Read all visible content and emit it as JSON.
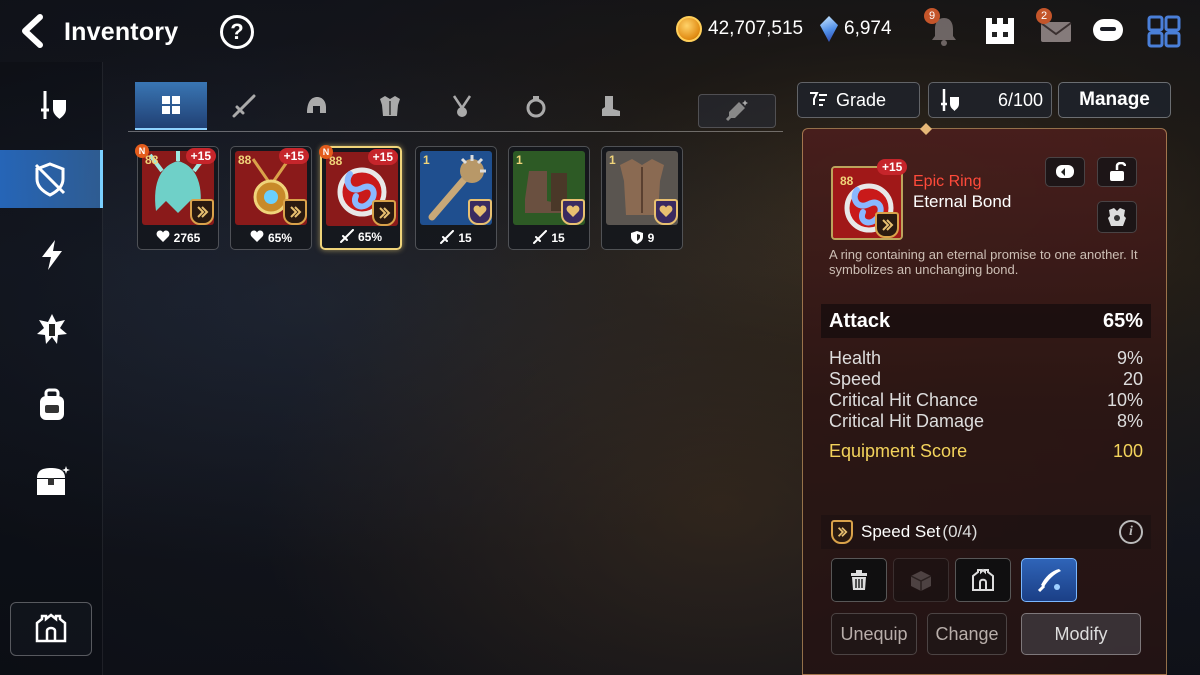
{
  "header": {
    "title": "Inventory",
    "help": "?",
    "gold": "42,707,515",
    "gems": "6,974",
    "notif_count": "9",
    "mail_count": "2"
  },
  "sidebar": {
    "items": [
      {
        "icon": "equipment-icon"
      },
      {
        "icon": "artifact-shield-icon",
        "active": true
      },
      {
        "icon": "lightning-icon"
      },
      {
        "icon": "catalyst-icon"
      },
      {
        "icon": "bag-icon"
      },
      {
        "icon": "chest-icon"
      }
    ],
    "bottom_icon": "fortress-icon"
  },
  "tabs": [
    {
      "icon": "grid-icon",
      "active": true
    },
    {
      "icon": "sword-icon"
    },
    {
      "icon": "helmet-icon"
    },
    {
      "icon": "armor-icon"
    },
    {
      "icon": "necklace-icon"
    },
    {
      "icon": "ring-icon"
    },
    {
      "icon": "boots-icon"
    }
  ],
  "items": [
    {
      "level": "88",
      "plus": "+15",
      "new": "N",
      "stat": "2765",
      "stat_icon": "heart-icon",
      "set": "speed-set-icon",
      "color": "#8a1a1a",
      "type": "helmet"
    },
    {
      "level": "88",
      "plus": "+15",
      "new": "",
      "stat": "65%",
      "stat_icon": "heart-icon",
      "set": "speed-set-icon",
      "color": "#8a1a1a",
      "type": "necklace"
    },
    {
      "level": "88",
      "plus": "+15",
      "new": "N",
      "stat": "65%",
      "stat_icon": "sword-icon",
      "set": "speed-set-icon",
      "color": "#8a1a1a",
      "type": "ring",
      "selected": true
    },
    {
      "level": "1",
      "plus": "",
      "new": "",
      "stat": "15",
      "stat_icon": "sword-icon",
      "set": "heart-set-icon",
      "color": "#1f4f8f",
      "type": "club"
    },
    {
      "level": "1",
      "plus": "",
      "new": "",
      "stat": "15",
      "stat_icon": "sword-icon",
      "set": "heart-set-icon",
      "color": "#2d5a25",
      "type": "boots"
    },
    {
      "level": "1",
      "plus": "",
      "new": "",
      "stat": "9",
      "stat_icon": "shield-icon",
      "set": "heart-set-icon",
      "color": "#5a5550",
      "type": "armor"
    }
  ],
  "controls": {
    "grade_label": "Grade",
    "capacity": "6/100",
    "manage_label": "Manage"
  },
  "detail": {
    "level": "88",
    "plus": "+15",
    "rarity": "Epic Ring",
    "name": "Eternal Bond",
    "description": "A ring containing an eternal promise to one another. It symbolizes an unchanging bond.",
    "main_stat": {
      "label": "Attack",
      "value": "65%"
    },
    "substats": [
      {
        "label": "Health",
        "value": "9%"
      },
      {
        "label": "Speed",
        "value": "20"
      },
      {
        "label": "Critical Hit Chance",
        "value": "10%"
      },
      {
        "label": "Critical Hit Damage",
        "value": "8%"
      }
    ],
    "score": {
      "label": "Equipment Score",
      "value": "100"
    },
    "set_name": "Speed Set",
    "set_progress": "(0/4)",
    "buttons": {
      "unequip": "Unequip",
      "change": "Change",
      "modify": "Modify"
    }
  },
  "colors": {
    "accent_blue": "#4a9bf0",
    "rarity_red": "#ff4a3a",
    "score_gold": "#f3d35c"
  }
}
